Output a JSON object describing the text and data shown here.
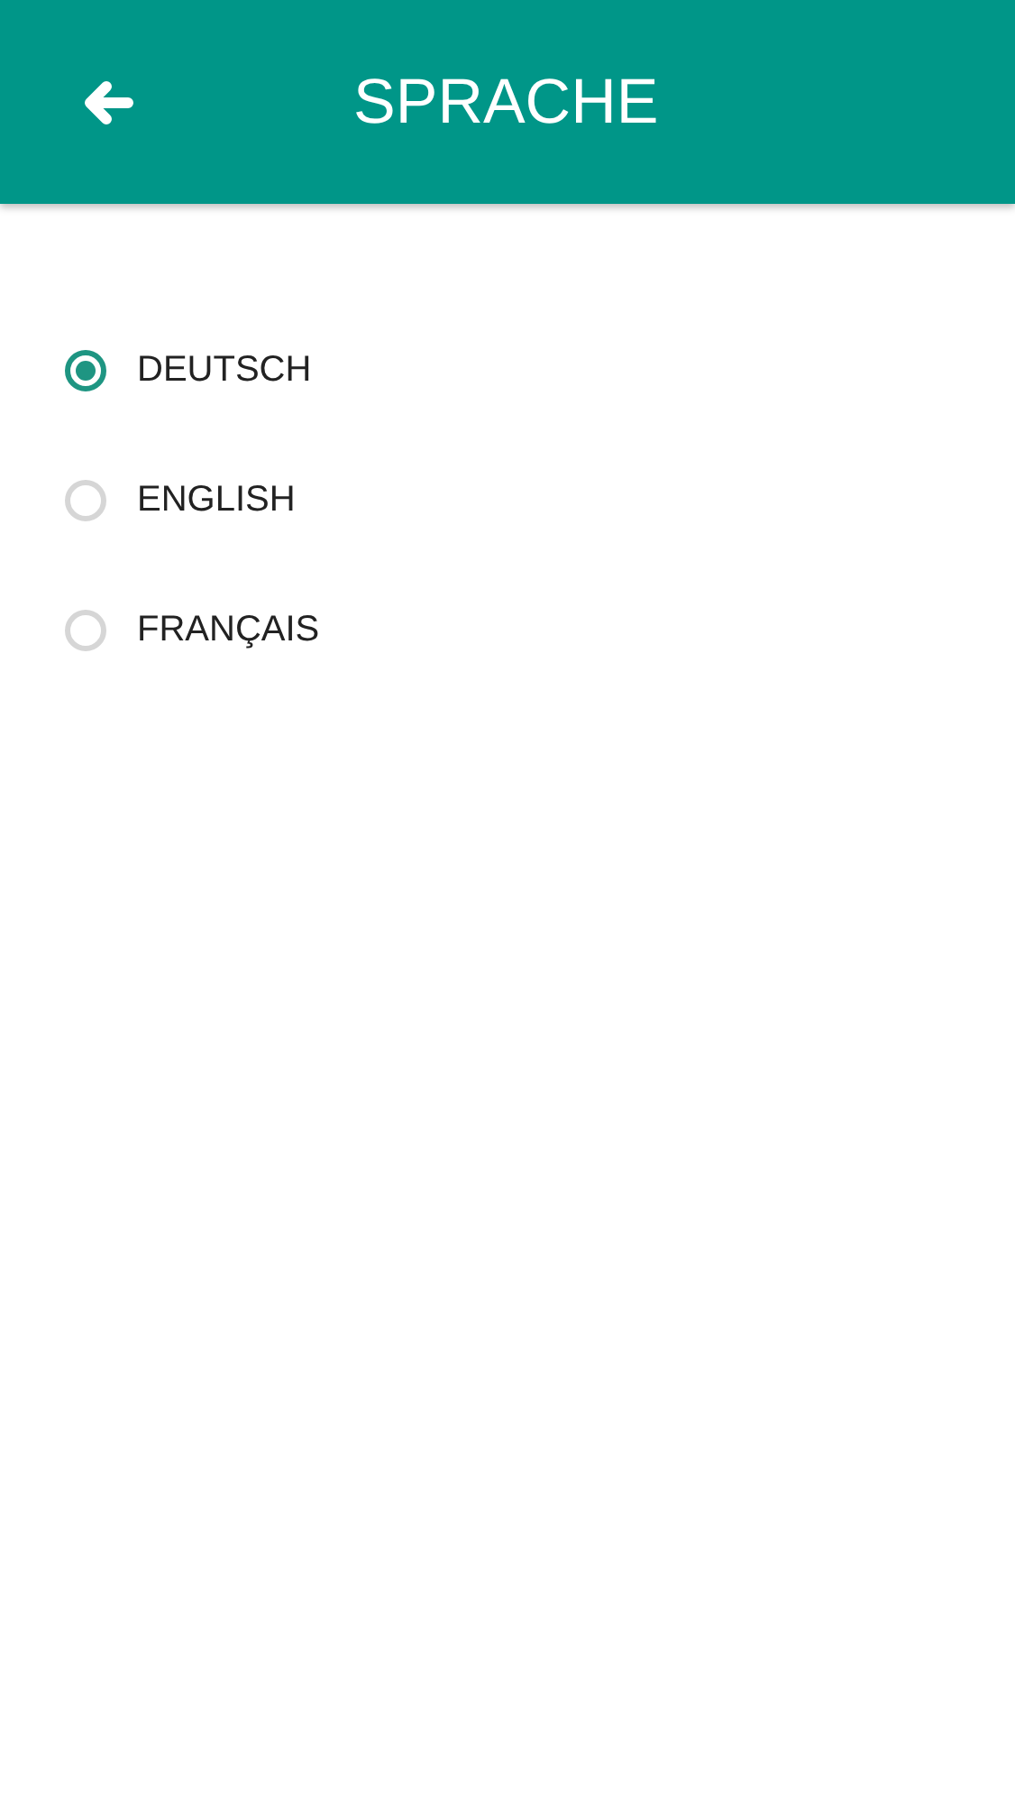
{
  "header": {
    "title": "SPRACHE"
  },
  "languages": [
    {
      "label": "DEUTSCH",
      "selected": true
    },
    {
      "label": "ENGLISH",
      "selected": false
    },
    {
      "label": "FRANÇAIS",
      "selected": false
    }
  ]
}
